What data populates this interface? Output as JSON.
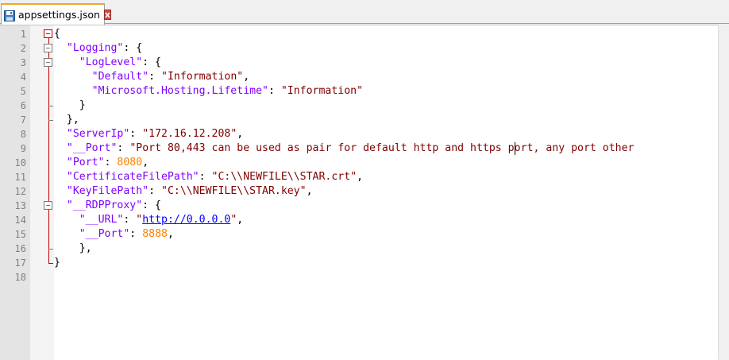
{
  "tab": {
    "label": "appsettings.json",
    "close_glyph": "x",
    "icon": "save-icon"
  },
  "colors": {
    "keyword": "#8000ff",
    "string": "#800000",
    "number": "#ff8000",
    "link": "#0000ff",
    "fold_marker": "#c00000",
    "current_line": "#e8e8ff"
  },
  "editor": {
    "line_numbers": [
      "1",
      "2",
      "3",
      "4",
      "5",
      "6",
      "7",
      "8",
      "9",
      "10",
      "11",
      "12",
      "13",
      "14",
      "15",
      "16",
      "17",
      "18"
    ],
    "lines": [
      [
        {
          "t": "p",
          "v": "{"
        }
      ],
      [
        {
          "t": "p",
          "v": "  "
        },
        {
          "t": "k",
          "v": "\"Logging\""
        },
        {
          "t": "p",
          "v": ": {"
        }
      ],
      [
        {
          "t": "p",
          "v": "    "
        },
        {
          "t": "k",
          "v": "\"LogLevel\""
        },
        {
          "t": "p",
          "v": ": {"
        }
      ],
      [
        {
          "t": "p",
          "v": "      "
        },
        {
          "t": "k",
          "v": "\"Default\""
        },
        {
          "t": "p",
          "v": ": "
        },
        {
          "t": "s",
          "v": "\"Information\""
        },
        {
          "t": "p",
          "v": ","
        }
      ],
      [
        {
          "t": "p",
          "v": "      "
        },
        {
          "t": "k",
          "v": "\"Microsoft.Hosting.Lifetime\""
        },
        {
          "t": "p",
          "v": ": "
        },
        {
          "t": "s",
          "v": "\"Information\""
        }
      ],
      [
        {
          "t": "p",
          "v": "    }"
        }
      ],
      [
        {
          "t": "p",
          "v": "  },"
        }
      ],
      [
        {
          "t": "p",
          "v": "  "
        },
        {
          "t": "k",
          "v": "\"ServerIp\""
        },
        {
          "t": "p",
          "v": ": "
        },
        {
          "t": "s",
          "v": "\"172.16.12.208\""
        },
        {
          "t": "p",
          "v": ","
        }
      ],
      [
        {
          "t": "p",
          "v": "  "
        },
        {
          "t": "k",
          "v": "\"__Port\""
        },
        {
          "t": "p",
          "v": ": "
        },
        {
          "t": "s",
          "v": "\"Port 80,443 can be used as pair for default http and https port, any port other"
        }
      ],
      [
        {
          "t": "p",
          "v": "  "
        },
        {
          "t": "k",
          "v": "\"Port\""
        },
        {
          "t": "p",
          "v": ": "
        },
        {
          "t": "n",
          "v": "8080"
        },
        {
          "t": "p",
          "v": ","
        }
      ],
      [
        {
          "t": "p",
          "v": "  "
        },
        {
          "t": "k",
          "v": "\"CertificateFilePath\""
        },
        {
          "t": "p",
          "v": ": "
        },
        {
          "t": "s",
          "v": "\"C:\\\\NEWFILE\\\\STAR.crt\""
        },
        {
          "t": "p",
          "v": ","
        }
      ],
      [
        {
          "t": "p",
          "v": "  "
        },
        {
          "t": "k",
          "v": "\"KeyFilePath\""
        },
        {
          "t": "p",
          "v": ": "
        },
        {
          "t": "s",
          "v": "\"C:\\\\NEWFILE\\\\STAR.key\""
        },
        {
          "t": "p",
          "v": ","
        }
      ],
      [
        {
          "t": "p",
          "v": "  "
        },
        {
          "t": "k",
          "v": "\"__RDPProxy\""
        },
        {
          "t": "p",
          "v": ": {"
        }
      ],
      [
        {
          "t": "p",
          "v": "    "
        },
        {
          "t": "k",
          "v": "\"__URL\""
        },
        {
          "t": "p",
          "v": ": "
        },
        {
          "t": "s",
          "v": "\""
        },
        {
          "t": "l",
          "v": "http://0.0.0.0"
        },
        {
          "t": "s",
          "v": "\""
        },
        {
          "t": "p",
          "v": ","
        }
      ],
      [
        {
          "t": "p",
          "v": "    "
        },
        {
          "t": "k",
          "v": "\"__Port\""
        },
        {
          "t": "p",
          "v": ": "
        },
        {
          "t": "n",
          "v": "8888"
        },
        {
          "t": "p",
          "v": ","
        }
      ],
      [
        {
          "t": "p",
          "v": "    },"
        }
      ],
      [
        {
          "t": "p",
          "v": "}"
        }
      ],
      []
    ],
    "current_line": 9,
    "caret_column": 73
  }
}
